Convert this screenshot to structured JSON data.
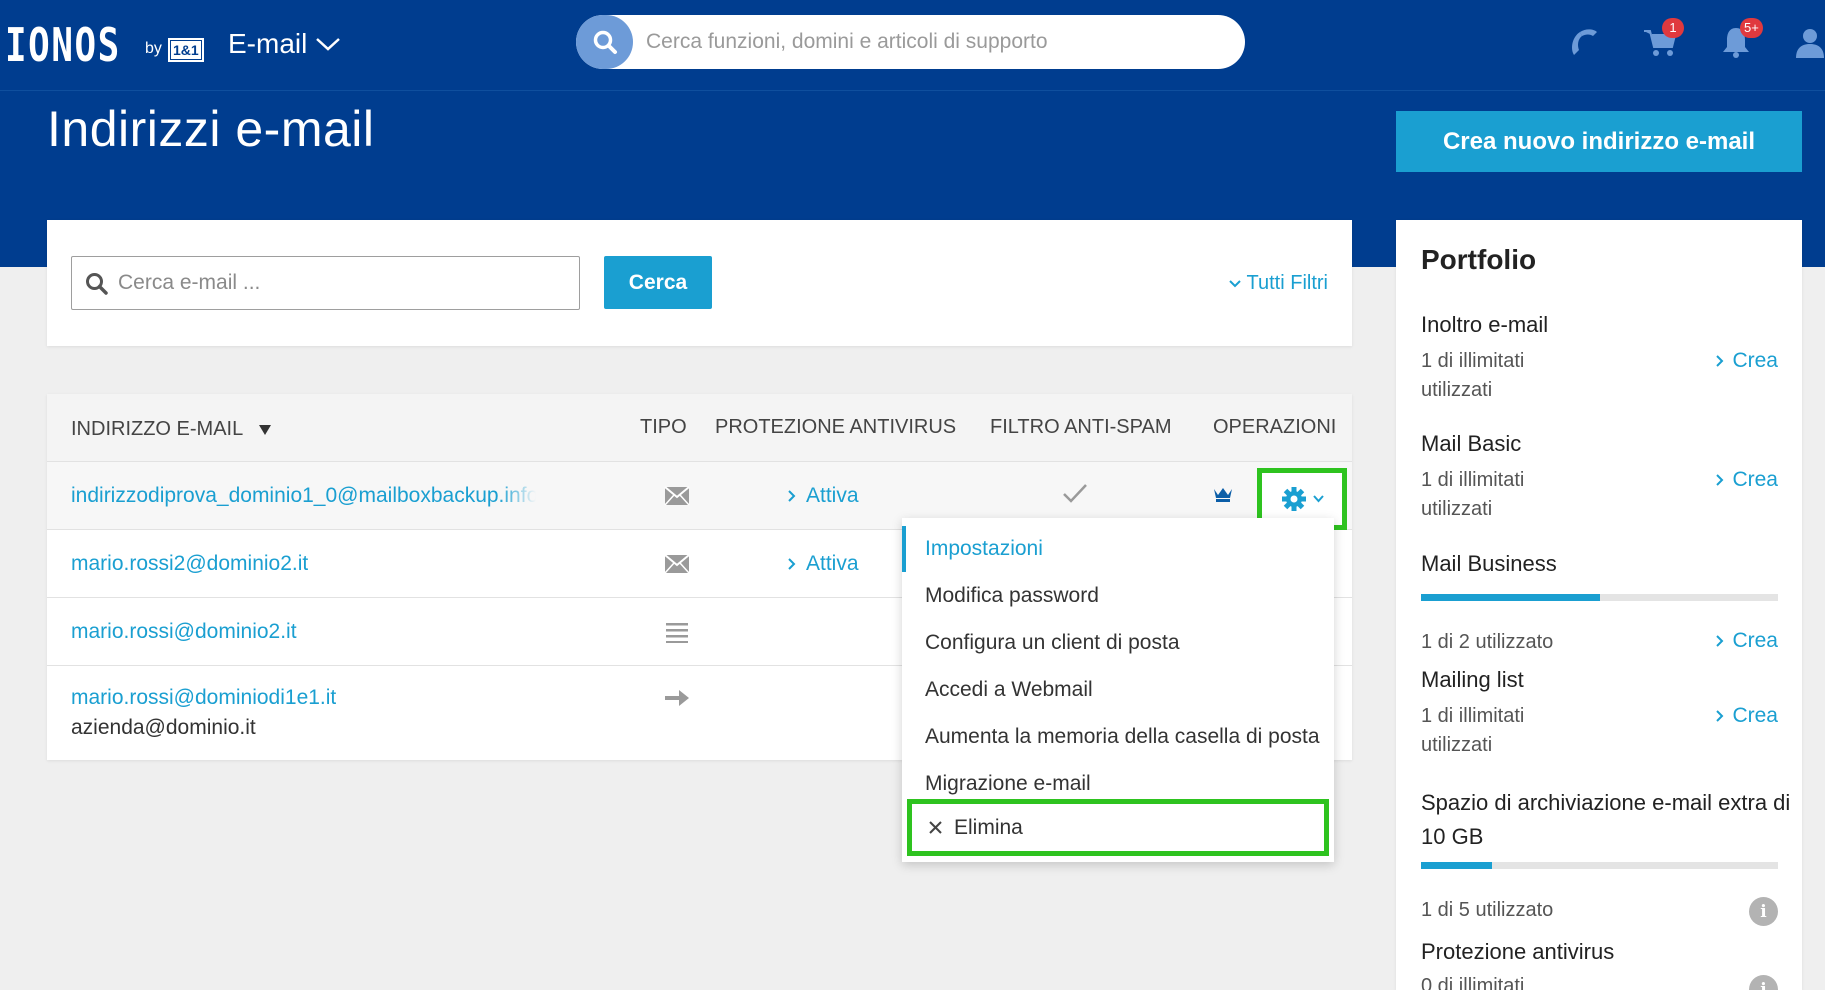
{
  "header": {
    "logo": "IONOS",
    "logo_by": "by",
    "logo_brand": "1&1",
    "product_menu": "E-mail",
    "search_placeholder": "Cerca funzioni, domini e articoli di supporto",
    "cart_badge": "1",
    "notifications_badge": "5+",
    "icons": [
      "phone-icon",
      "cart-icon",
      "bell-icon",
      "user-icon"
    ]
  },
  "page": {
    "title": "Indirizzi e-mail",
    "create_button": "Crea nuovo indirizzo e-mail"
  },
  "filters": {
    "search_placeholder": "Cerca e-mail ...",
    "search_button": "Cerca",
    "all_filters": "Tutti Filtri"
  },
  "table": {
    "headers": {
      "email": "INDIRIZZO E-MAIL",
      "type": "TIPO",
      "antivirus": "PROTEZIONE ANTIVIRUS",
      "antispam": "FILTRO ANTI-SPAM",
      "operations": "OPERAZIONI"
    },
    "rows": [
      {
        "email": "indirizzodiprova_dominio1_0@mailboxbackup.info",
        "type_icon": "envelope-icon",
        "antivirus": "Attiva",
        "antispam_icon": "check-icon",
        "badge_icon": "crown-icon"
      },
      {
        "email": "mario.rossi2@dominio2.it",
        "type_icon": "envelope-icon",
        "antivirus": "Attiva"
      },
      {
        "email": "mario.rossi@dominio2.it",
        "type_icon": "list-icon"
      },
      {
        "email": "mario.rossi@dominiodi1e1.it",
        "alias": "azienda@dominio.it",
        "type_icon": "arrow-right-icon"
      }
    ]
  },
  "dropdown": {
    "items": [
      "Impostazioni",
      "Modifica password",
      "Configura un client di posta",
      "Accedi a Webmail",
      "Aumenta la memoria della casella di posta",
      "Migrazione e-mail"
    ],
    "delete": "Elimina"
  },
  "portfolio": {
    "title": "Portfolio",
    "create_label": "Crea",
    "items": [
      {
        "name": "Inoltro e-mail",
        "usage": "1 di illimitati utilizzati"
      },
      {
        "name": "Mail Basic",
        "usage": "1 di illimitati utilizzati"
      },
      {
        "name": "Mail Business",
        "usage": "1 di 2 utilizzato",
        "fill_fraction": 0.5
      },
      {
        "name": "Mailing list",
        "usage": "1 di illimitati utilizzati"
      },
      {
        "name": "Spazio di archiviazione e-mail extra di 10 GB",
        "usage": "1 di 5 utilizzato",
        "fill_fraction": 0.2
      },
      {
        "name": "Protezione antivirus",
        "usage": "0 di illimitati"
      }
    ]
  },
  "colors": {
    "header_blue": "#003d8f",
    "accent": "#1a9fd1",
    "highlight_green": "#2ec31f",
    "badge_red": "#e0393e"
  }
}
